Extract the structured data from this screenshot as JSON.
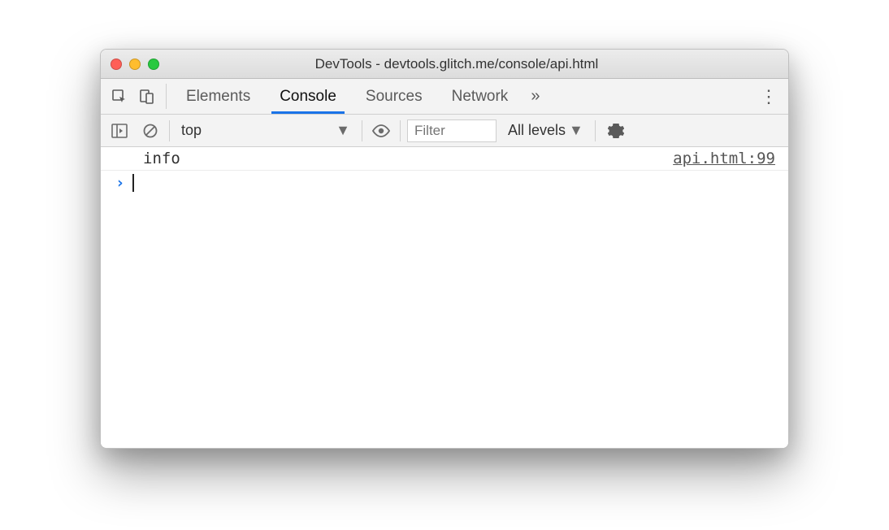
{
  "window": {
    "title": "DevTools - devtools.glitch.me/console/api.html"
  },
  "tabs": {
    "elements": "Elements",
    "console": "Console",
    "sources": "Sources",
    "network": "Network"
  },
  "filterbar": {
    "context": "top",
    "filter_placeholder": "Filter",
    "levels": "All levels"
  },
  "console": {
    "log_message": "info",
    "log_source": "api.html:99"
  }
}
